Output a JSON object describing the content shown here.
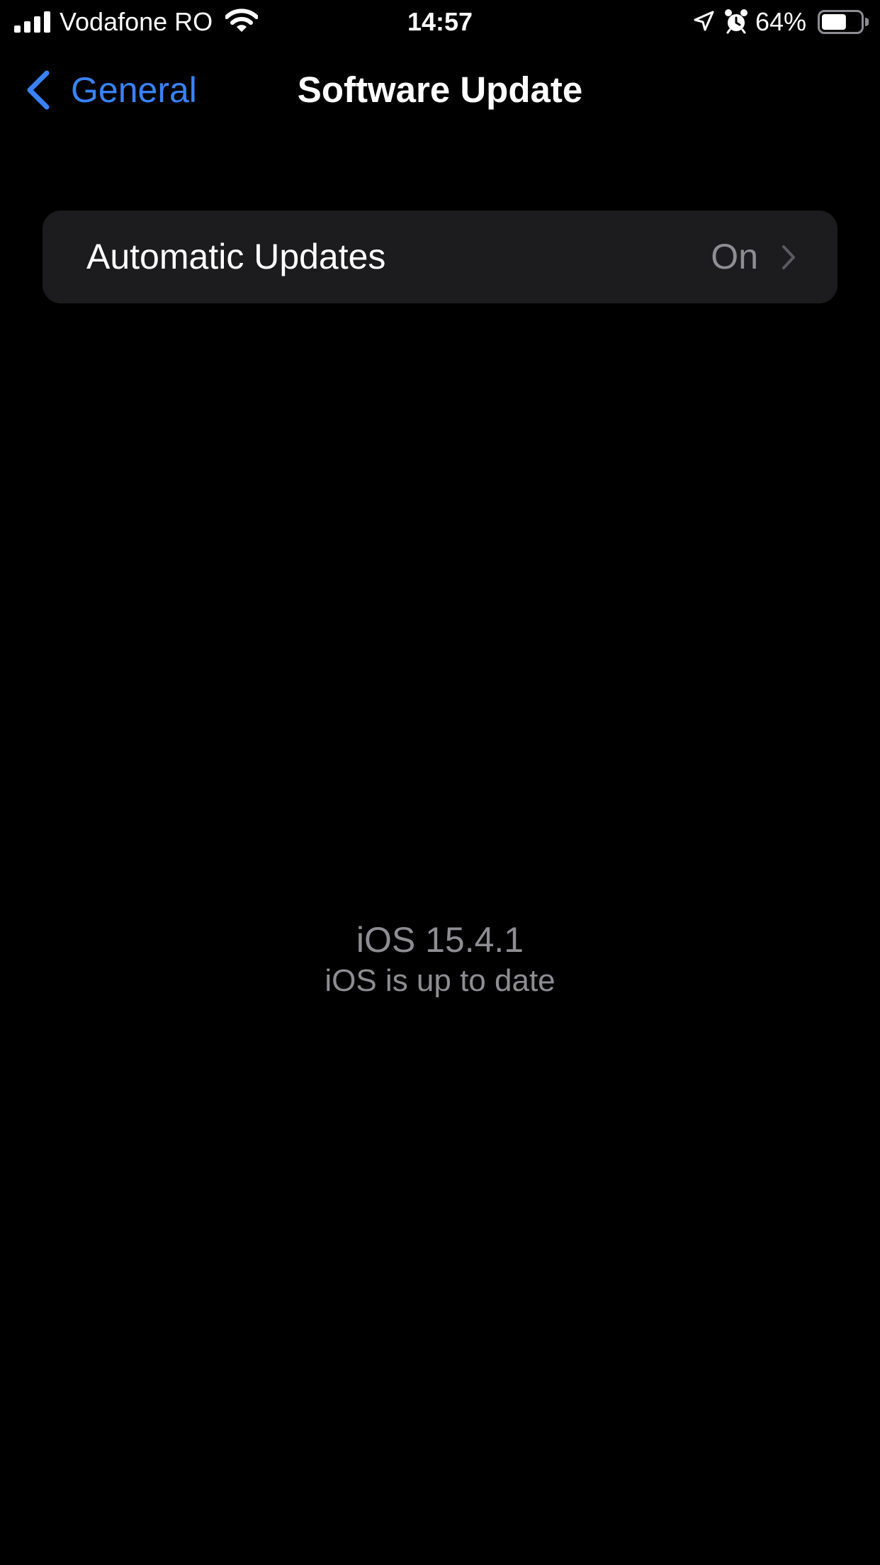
{
  "status_bar": {
    "carrier": "Vodafone RO",
    "time": "14:57",
    "battery_percent": "64%",
    "battery_level": 0.64,
    "signal_bars": 4,
    "icons": [
      "signal-icon",
      "wifi-icon",
      "location-icon",
      "alarm-icon",
      "battery-icon"
    ]
  },
  "nav": {
    "back_label": "General",
    "title": "Software Update",
    "accent_color": "#3a82f7"
  },
  "settings": {
    "automatic_updates": {
      "label": "Automatic Updates",
      "value": "On"
    }
  },
  "status": {
    "version": "iOS 15.4.1",
    "message": "iOS is up to date"
  },
  "colors": {
    "background": "#000000",
    "group_background": "#1c1c1e",
    "secondary_text": "#8d8d93"
  }
}
